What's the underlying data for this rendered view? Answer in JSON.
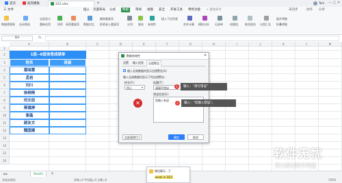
{
  "titlebar": {
    "tabs": [
      {
        "label": "首页",
        "color": "#2d7ff9"
      },
      {
        "label": "稻壳模板",
        "color": "#e53935"
      },
      {
        "label": "222.xlsx",
        "color": "#2a8f4a"
      }
    ],
    "user": "Tom"
  },
  "menubar": {
    "file": "三 文件",
    "items": [
      "插入",
      "页面布局",
      "公式",
      "数据",
      "审阅",
      "视图",
      "安全",
      "开发工具",
      "特色功能"
    ],
    "active": "数据",
    "search": "查找命令",
    "right_items": [
      "未同步",
      "协作",
      "分享"
    ]
  },
  "ribbon": {
    "buttons": [
      "数据透视表",
      "自动筛选",
      "全部显示",
      "重新应用",
      "排序",
      "高亮重复项",
      "数据对比",
      "删除重复项",
      "拒绝录入重复项",
      "分列",
      "填充",
      "有效性",
      "插入下拉列表",
      "合并计算",
      "模拟分析",
      "记录单",
      "创建组",
      "取消组合",
      "分类汇总",
      "展开明细",
      "折叠明细"
    ]
  },
  "formulabar": {
    "cellref": "B3",
    "fx": "fx"
  },
  "sheet": {
    "col_headers": [
      "A",
      "B",
      "C",
      "D",
      "E",
      "F",
      "G",
      "H",
      "I",
      "J",
      "K",
      "L",
      "M",
      "N",
      "O"
    ],
    "row_numbers": [
      "1",
      "2",
      "3",
      "4",
      "5",
      "6",
      "7",
      "8",
      "9",
      "10",
      "11",
      "12",
      "13",
      "14",
      "15",
      "16",
      "17",
      "18",
      "19",
      "20"
    ],
    "title": "1班--8班体育成绩单",
    "header_name": "姓名",
    "header_class": "班级",
    "names": [
      "葛晓慧",
      "孟岩",
      "刘川",
      "徐俐俐",
      "何文欣",
      "蒋璐婷",
      "谢晶",
      "郝友文",
      "魏国建"
    ],
    "title_color": "#2d8ff5",
    "header_color": "#3d9cf7",
    "name_color": "#1a4d8f"
  },
  "dialog": {
    "title": "数据有效性",
    "tabs": [
      "设置",
      "输入信息",
      "出错警告"
    ],
    "active_tab": "出错警告",
    "checkbox_label": "输入无效数据时显示出错警告(S)",
    "section_label": "输入无效数据时显示下列出错警告：",
    "style_label": "样式(Y)：",
    "style_value": "停止",
    "title_label": "标题(T)：",
    "title_value": "请填写错误",
    "message_label": "错误信息(E)：",
    "message_value": "您输入有误",
    "clear_all": "全部清除(C)",
    "ok": "确定",
    "cancel": "取消"
  },
  "callouts": [
    {
      "num": "1",
      "text": "输入：“请写错误”"
    },
    {
      "num": "2",
      "text": "输入：“您输入错误”。"
    }
  ],
  "sheetbar": {
    "sheet_tab": "Sheet1"
  },
  "statusbar": {
    "left": "文档未保存",
    "mid": "求和=0  平均值=0  计数=0",
    "zoom": "100%"
  },
  "watermark": {
    "title": "软件无忧",
    "subtitle": "努力解决软件问题"
  },
  "popup": {
    "title": "微信聊天...下",
    "body": "weak in D22"
  }
}
